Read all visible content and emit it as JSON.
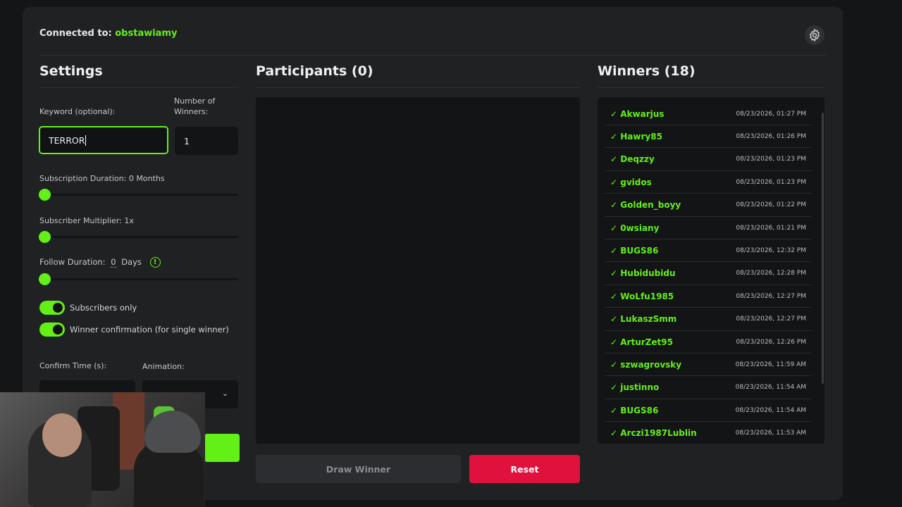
{
  "header": {
    "connected_label": "Connected to:",
    "channel": "obstawiamy"
  },
  "settings": {
    "title": "Settings",
    "keyword_label": "Keyword (optional):",
    "keyword_value": "TERROR",
    "winners_label": "Number of Winners:",
    "winners_value": "1",
    "sub_duration_label": "Subscription Duration: 0 Months",
    "sub_duration_value": 0,
    "sub_multiplier_label": "Subscriber Multiplier: 1x",
    "sub_multiplier_value": 1,
    "follow_label": "Follow Duration:",
    "follow_value": "0",
    "follow_unit": "Days",
    "info_glyph": "!",
    "subscribers_only_label": "Subscribers only",
    "subscribers_only": true,
    "winner_confirm_label": "Winner confirmation (for single winner)",
    "winner_confirm": true,
    "confirm_time_label": "Confirm Time (s):",
    "animation_label": "Animation:",
    "chevron": "⌄"
  },
  "participants": {
    "title": "Participants (0)"
  },
  "winners": {
    "title": "Winners (18)",
    "check": "✓",
    "items": [
      {
        "name": "Akwarjus",
        "date": "08/23/2026, 01:27 PM"
      },
      {
        "name": "Hawry85",
        "date": "08/23/2026, 01:26 PM"
      },
      {
        "name": "Deqzzy",
        "date": "08/23/2026, 01:23 PM"
      },
      {
        "name": "gvidos",
        "date": "08/23/2026, 01:23 PM"
      },
      {
        "name": "Golden_boyy",
        "date": "08/23/2026, 01:22 PM"
      },
      {
        "name": "0wsiany",
        "date": "08/23/2026, 01:21 PM"
      },
      {
        "name": "BUGS86",
        "date": "08/23/2026, 12:32 PM"
      },
      {
        "name": "Hubidubidu",
        "date": "08/23/2026, 12:28 PM"
      },
      {
        "name": "WoLfu1985",
        "date": "08/23/2026, 12:27 PM"
      },
      {
        "name": "LukaszSmm",
        "date": "08/23/2026, 12:27 PM"
      },
      {
        "name": "ArturZet95",
        "date": "08/23/2026, 12:26 PM"
      },
      {
        "name": "szwagrovsky",
        "date": "08/23/2026, 11:59 AM"
      },
      {
        "name": "justinno",
        "date": "08/23/2026, 11:54 AM"
      },
      {
        "name": "BUGS86",
        "date": "08/23/2026, 11:54 AM"
      },
      {
        "name": "Arczi1987Lublin",
        "date": "08/23/2026, 11:53 AM"
      }
    ]
  },
  "actions": {
    "draw": "Draw Winner",
    "reset": "Reset"
  },
  "colors": {
    "accent": "#62f016",
    "danger": "#e0113d",
    "panel": "#1f2123"
  },
  "icons": {
    "settings": "gear-icon",
    "info": "info-icon"
  }
}
